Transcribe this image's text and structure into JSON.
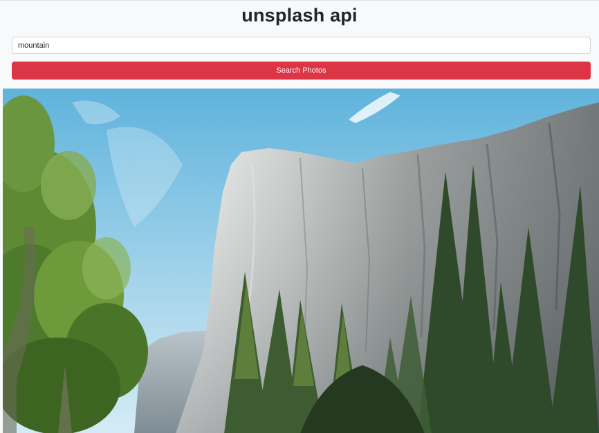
{
  "header": {
    "title": "unsplash api"
  },
  "search": {
    "value": "mountain",
    "button_label": "Search Photos"
  },
  "result": {
    "subject": "granite cliff with pine trees under blue sky"
  },
  "colors": {
    "background": "#f8f9fa",
    "button": "#dc3545",
    "button_text": "#ffffff"
  }
}
